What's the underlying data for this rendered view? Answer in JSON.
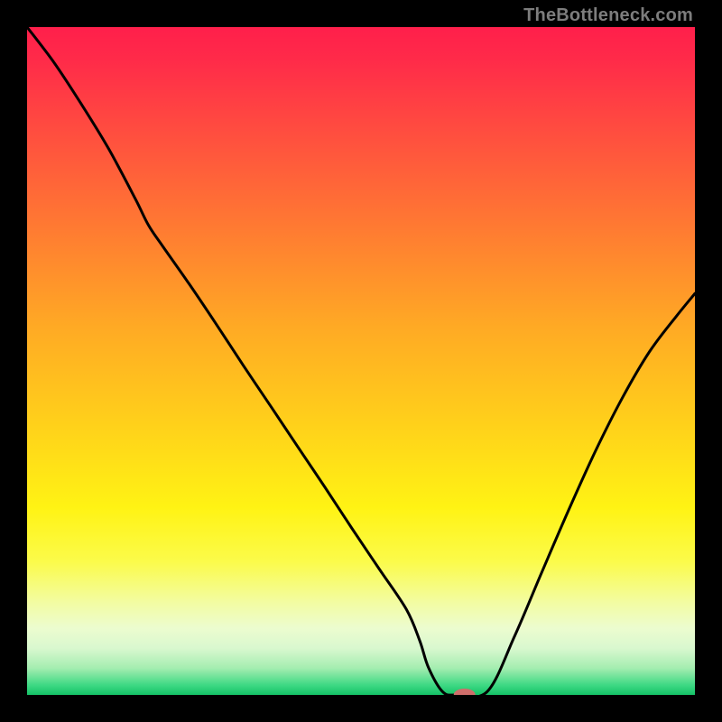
{
  "watermark": "TheBottleneck.com",
  "chart_data": {
    "type": "line",
    "title": "",
    "xlabel": "",
    "ylabel": "",
    "xlim": [
      0,
      100
    ],
    "ylim": [
      0,
      100
    ],
    "grid": false,
    "legend": false,
    "gradient_stops": [
      {
        "offset": 0.0,
        "color": "#ff1f4b"
      },
      {
        "offset": 0.05,
        "color": "#ff2b49"
      },
      {
        "offset": 0.15,
        "color": "#ff4b40"
      },
      {
        "offset": 0.3,
        "color": "#ff7a32"
      },
      {
        "offset": 0.45,
        "color": "#ffaa24"
      },
      {
        "offset": 0.6,
        "color": "#ffd21a"
      },
      {
        "offset": 0.72,
        "color": "#fff314"
      },
      {
        "offset": 0.8,
        "color": "#fbfb4a"
      },
      {
        "offset": 0.86,
        "color": "#f3fca0"
      },
      {
        "offset": 0.9,
        "color": "#ecfccf"
      },
      {
        "offset": 0.93,
        "color": "#d9f8cf"
      },
      {
        "offset": 0.96,
        "color": "#a4edb0"
      },
      {
        "offset": 0.985,
        "color": "#3fd984"
      },
      {
        "offset": 1.0,
        "color": "#14c267"
      }
    ],
    "series": [
      {
        "name": "bottleneck-curve",
        "color": "#000000",
        "x": [
          0.0,
          4.1,
          8.1,
          12.2,
          16.2,
          18.2,
          20.3,
          24.3,
          28.4,
          32.4,
          36.5,
          40.5,
          44.6,
          48.6,
          52.7,
          56.8,
          58.8,
          60.1,
          62.2,
          64.2,
          68.9,
          73.0,
          77.0,
          81.1,
          85.1,
          89.2,
          93.2,
          97.3,
          100.0
        ],
        "y": [
          100.0,
          94.6,
          88.5,
          81.8,
          74.3,
          70.3,
          67.2,
          61.5,
          55.4,
          49.3,
          43.2,
          37.2,
          31.1,
          25.0,
          18.9,
          12.8,
          8.1,
          4.1,
          0.5,
          0.0,
          0.5,
          8.8,
          18.2,
          27.7,
          36.5,
          44.6,
          51.4,
          56.8,
          60.1
        ]
      }
    ],
    "marker": {
      "x": 65.5,
      "y": 0.0,
      "color": "#cf6e6b",
      "rx": 1.62,
      "ry": 0.95
    },
    "annotations": []
  }
}
